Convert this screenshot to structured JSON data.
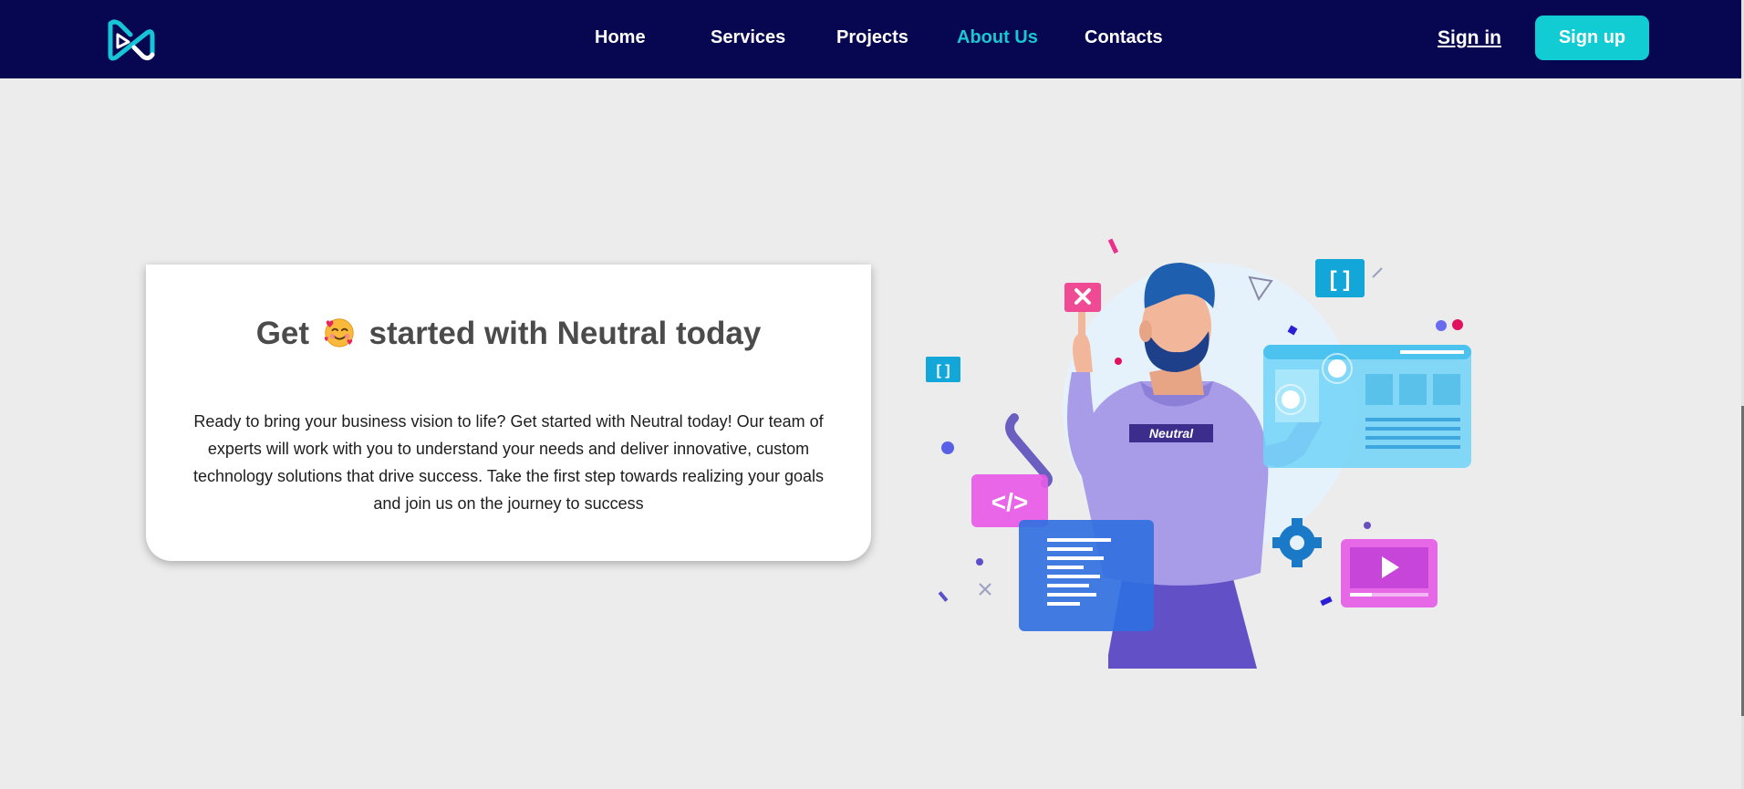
{
  "header": {
    "logo": "neutral-logo",
    "nav": [
      {
        "label": "Home",
        "active": false
      },
      {
        "label": "Services",
        "active": false
      },
      {
        "label": "Projects",
        "active": false
      },
      {
        "label": "About Us",
        "active": true
      },
      {
        "label": "Contacts",
        "active": false
      }
    ],
    "signin_label": "Sign in",
    "signup_label": "Sign up"
  },
  "hero": {
    "title_prefix": "Get",
    "title_emoji": "smiling-face-with-hearts-emoji",
    "title_suffix": "started with Neutral today",
    "description": "Ready to bring your business vision to life? Get started with Neutral today! Our team of experts will work with you to understand your needs and deliver innovative, custom technology solutions that drive success. Take the first step towards realizing your goals and join us on the journey to success"
  },
  "illustration": {
    "shirt_label": "Neutral",
    "code_icon": "</>",
    "bracket_icon": "[ ]"
  },
  "colors": {
    "header_bg": "#070650",
    "accent": "#12ccd3",
    "active_link": "#19c7d3",
    "page_bg": "#ececec"
  }
}
